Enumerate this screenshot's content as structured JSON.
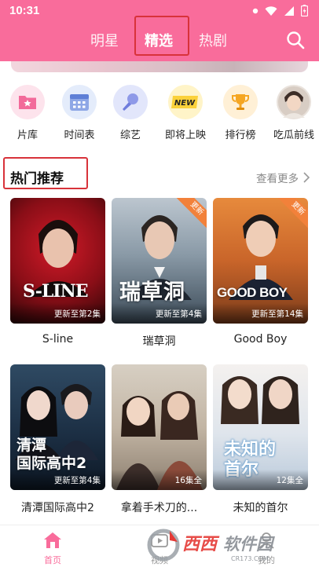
{
  "status": {
    "time": "10:31"
  },
  "tabs": [
    "明星",
    "精选",
    "热剧"
  ],
  "quick_nav": [
    {
      "label": "片库",
      "icon": "folder-star-icon"
    },
    {
      "label": "时间表",
      "icon": "calendar-icon"
    },
    {
      "label": "综艺",
      "icon": "microphone-icon"
    },
    {
      "label": "即将上映",
      "icon": "new-badge-icon"
    },
    {
      "label": "排行榜",
      "icon": "trophy-icon"
    },
    {
      "label": "吃瓜前线",
      "icon": "avatar-icon"
    }
  ],
  "section": {
    "title": "热门推荐",
    "more": "查看更多"
  },
  "cards": [
    {
      "caption": "S-line",
      "poster_text": "S-LINE",
      "episode": "更新至第2集",
      "ribbon": ""
    },
    {
      "caption": "瑞草洞",
      "poster_text": "瑞草洞",
      "episode": "更新至第4集",
      "ribbon": "更新"
    },
    {
      "caption": "Good Boy",
      "poster_text": "GOOD BOY",
      "episode": "更新至第14集",
      "ribbon": "更新"
    },
    {
      "caption": "清潭国际高中2",
      "poster_text": "清潭国际高中2",
      "episode": "更新至第4集",
      "ribbon": ""
    },
    {
      "caption": "拿着手术刀的...",
      "poster_text": "",
      "episode": "16集全",
      "ribbon": ""
    },
    {
      "caption": "未知的首尔",
      "poster_text": "未知的首尔",
      "episode": "12集全",
      "ribbon": ""
    }
  ],
  "bottom_nav": [
    "首页",
    "视频",
    "我的"
  ],
  "watermark": {
    "text": "西西软件园",
    "sub": "CR173.COM"
  },
  "colors": {
    "brand": "#f96c9b",
    "highlight_box": "#d8323a",
    "ribbon": "#f2813a"
  }
}
